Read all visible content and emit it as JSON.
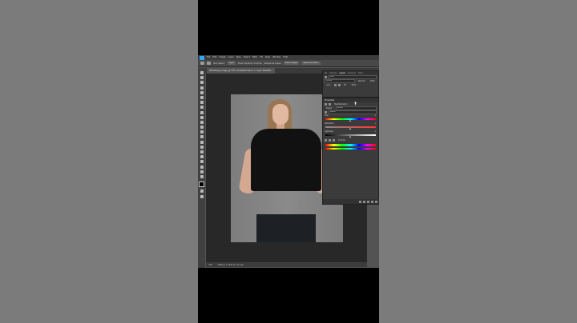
{
  "app": {
    "menu": [
      "File",
      "Edit",
      "Image",
      "Layer",
      "Type",
      "Select",
      "Filter",
      "3D",
      "View",
      "Window",
      "Help"
    ]
  },
  "options_bar": {
    "auto_select": "Auto-Select:",
    "auto_select_value": "Layer",
    "show_transform": "Show Transform Controls",
    "sample_all_layers": "Sample All Layers",
    "select_subject": "Select Subject",
    "select_and_mask": "Select and Mask..."
  },
  "document": {
    "tab_title": "WhatsApp_Image_@ 33% (Hue/Saturation 1, Layer Mask/8) *",
    "zoom": "33%",
    "dimensions": "1080 px x 1920 px (72 ppi)"
  },
  "layers_panel": {
    "tabs": [
      "3D",
      "Libraries",
      "Layers",
      "Channels",
      "Paths"
    ],
    "active_tab": "Layers",
    "search_placeholder": "Kind",
    "blend_mode": "Normal",
    "opacity_label": "Opacity:",
    "opacity_value": "100%",
    "lock_label": "Lock:",
    "fill_label": "Fill:",
    "fill_value": "100%"
  },
  "properties_panel": {
    "title": "Properties",
    "adjustment_name": "Hue/Saturation",
    "preset_label": "Preset:",
    "preset_value": "Default",
    "channel_value": "Master",
    "hue_label": "Hue:",
    "hue_value": "0",
    "saturation_label": "Saturation:",
    "saturation_value": "0",
    "lightness_label": "Lightness:",
    "lightness_value": "0",
    "colorize_label": "Colorize",
    "hue_position": 0.5,
    "saturation_position": 0.5,
    "lightness_position": 0.5
  },
  "colors": {
    "background": "#7b7b7b",
    "ps_chrome": "#535353",
    "panel": "#3b3b3b",
    "ps_blue": "#31a8ff"
  }
}
